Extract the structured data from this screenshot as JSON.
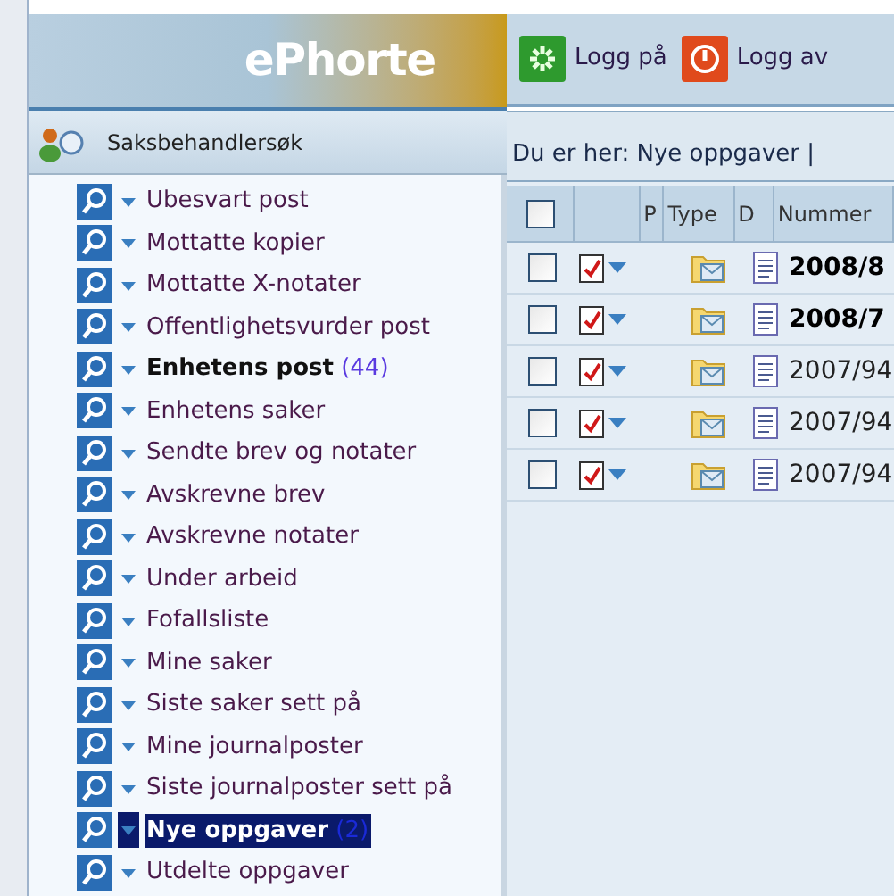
{
  "logo": {
    "text": "ePhorte"
  },
  "sidebar": {
    "heading": "Saksbehandlersøk",
    "items": [
      {
        "label": "Ubesvart post",
        "selected": false
      },
      {
        "label": "Mottatte kopier",
        "selected": false
      },
      {
        "label": "Mottatte X-notater",
        "selected": false
      },
      {
        "label": "Offentlighetsvurder post",
        "selected": false
      },
      {
        "label": "Enhetens post",
        "count": "(44)",
        "selected": false
      },
      {
        "label": "Enhetens saker",
        "selected": false
      },
      {
        "label": "Sendte brev og notater",
        "selected": false
      },
      {
        "label": "Avskrevne brev",
        "selected": false
      },
      {
        "label": "Avskrevne notater",
        "selected": false
      },
      {
        "label": "Under arbeid",
        "selected": false
      },
      {
        "label": "Fofallsliste",
        "selected": false
      },
      {
        "label": "Mine saker",
        "selected": false
      },
      {
        "label": "Siste saker sett på",
        "selected": false
      },
      {
        "label": "Mine journalposter",
        "selected": false
      },
      {
        "label": "Siste journalposter sett på",
        "selected": false
      },
      {
        "label": "Nye oppgaver",
        "count": "(2)",
        "selected": true
      },
      {
        "label": "Utdelte oppgaver",
        "selected": false
      }
    ]
  },
  "toolbar": {
    "buttons": [
      {
        "kind": "login",
        "label": "Logg på"
      },
      {
        "kind": "logout",
        "label": "Logg av"
      }
    ]
  },
  "breadcrumb": "Du er her: Nye oppgaver |",
  "table": {
    "columns": [
      "P",
      "Type",
      "D",
      "Nummer"
    ],
    "header_checked": false,
    "rows": [
      {
        "checked": false,
        "unread": true,
        "number": "2008/8"
      },
      {
        "checked": false,
        "unread": true,
        "number": "2008/7"
      },
      {
        "checked": false,
        "unread": false,
        "number": "2007/94"
      },
      {
        "checked": false,
        "unread": false,
        "number": "2007/94"
      },
      {
        "checked": false,
        "unread": false,
        "number": "2007/94"
      }
    ]
  }
}
